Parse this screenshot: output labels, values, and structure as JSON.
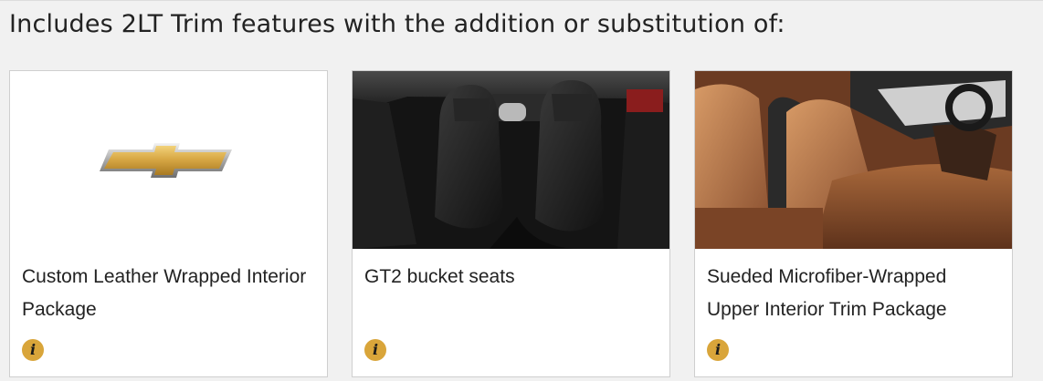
{
  "heading": "Includes 2LT Trim features with the addition or substitution of:",
  "cards": [
    {
      "title": "Custom Leather Wrapped Interior Package",
      "image": "chevrolet-bowtie-logo",
      "icon": "info-icon",
      "icon_glyph": "i"
    },
    {
      "title": "GT2 bucket seats",
      "image": "black-gt2-bucket-seats-photo",
      "icon": "info-icon",
      "icon_glyph": "i"
    },
    {
      "title": "Sueded Microfiber-Wrapped Upper Interior Trim Package",
      "image": "tan-leather-interior-photo",
      "icon": "info-icon",
      "icon_glyph": "i"
    }
  ],
  "colors": {
    "page_background": "#f1f1f1",
    "card_background": "#ffffff",
    "card_border": "#cfcfcf",
    "info_icon": "#d9a53a",
    "bowtie_gold": "#d4a544"
  }
}
